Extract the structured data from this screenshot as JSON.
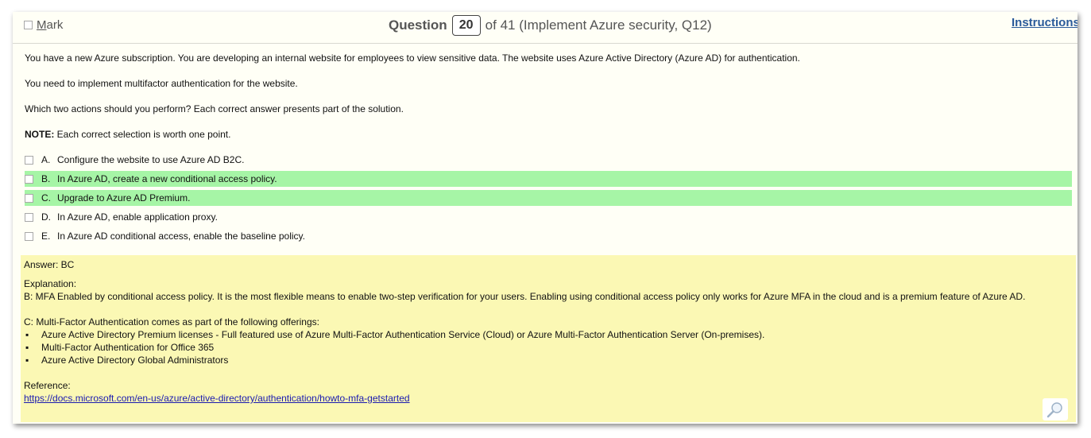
{
  "header": {
    "mark_label_first": "M",
    "mark_label_rest": "ark",
    "question_word": "Question",
    "question_number": "20",
    "question_suffix": "of 41 (Implement Azure security, Q12)",
    "instructions_link": "Instructions"
  },
  "question": {
    "p1": "You have a new Azure subscription. You are developing an internal website for employees to view sensitive data. The website uses Azure Active Directory (Azure AD) for authentication.",
    "p2": "You need to implement multifactor authentication for the website.",
    "p3": "Which two actions should you perform? Each correct answer presents part of the solution.",
    "note_label": "NOTE:",
    "note_text": " Each correct selection is worth one point."
  },
  "options": [
    {
      "letter": "A.",
      "text": "Configure the website to use Azure AD B2C.",
      "correct": false
    },
    {
      "letter": "B.",
      "text": "In Azure AD, create a new conditional access policy.",
      "correct": true
    },
    {
      "letter": "C.",
      "text": "Upgrade to Azure AD Premium.",
      "correct": true
    },
    {
      "letter": "D.",
      "text": "In Azure AD, enable application proxy.",
      "correct": false
    },
    {
      "letter": "E.",
      "text": "In Azure AD conditional access, enable the baseline policy.",
      "correct": false
    }
  ],
  "answer": {
    "answer_line": "Answer: BC",
    "explanation_label": "Explanation:",
    "explanation_b": "B: MFA Enabled by conditional access policy. It is the most flexible means to enable two-step verification for your users. Enabling using conditional access policy only works for Azure MFA in the cloud and is a premium feature of Azure AD.",
    "explanation_c": "C: Multi-Factor Authentication comes as part of the following offerings:",
    "bullet_char": "▪",
    "bullets": [
      "Azure Active Directory Premium licenses - Full featured use of Azure Multi-Factor Authentication Service (Cloud) or Azure Multi-Factor Authentication Server (On-premises).",
      "Multi-Factor Authentication for Office 365",
      "Azure Active Directory Global Administrators"
    ],
    "reference_label": "Reference:",
    "reference_url": "https://docs.microsoft.com/en-us/azure/active-directory/authentication/howto-mfa-getstarted"
  },
  "colors": {
    "correct_highlight": "#a6f5a6",
    "answer_background": "#fbf8b4",
    "link": "#1a1ab0",
    "instructions": "#2a5a9a"
  },
  "icons": {
    "zoom": "magnifier-icon"
  }
}
